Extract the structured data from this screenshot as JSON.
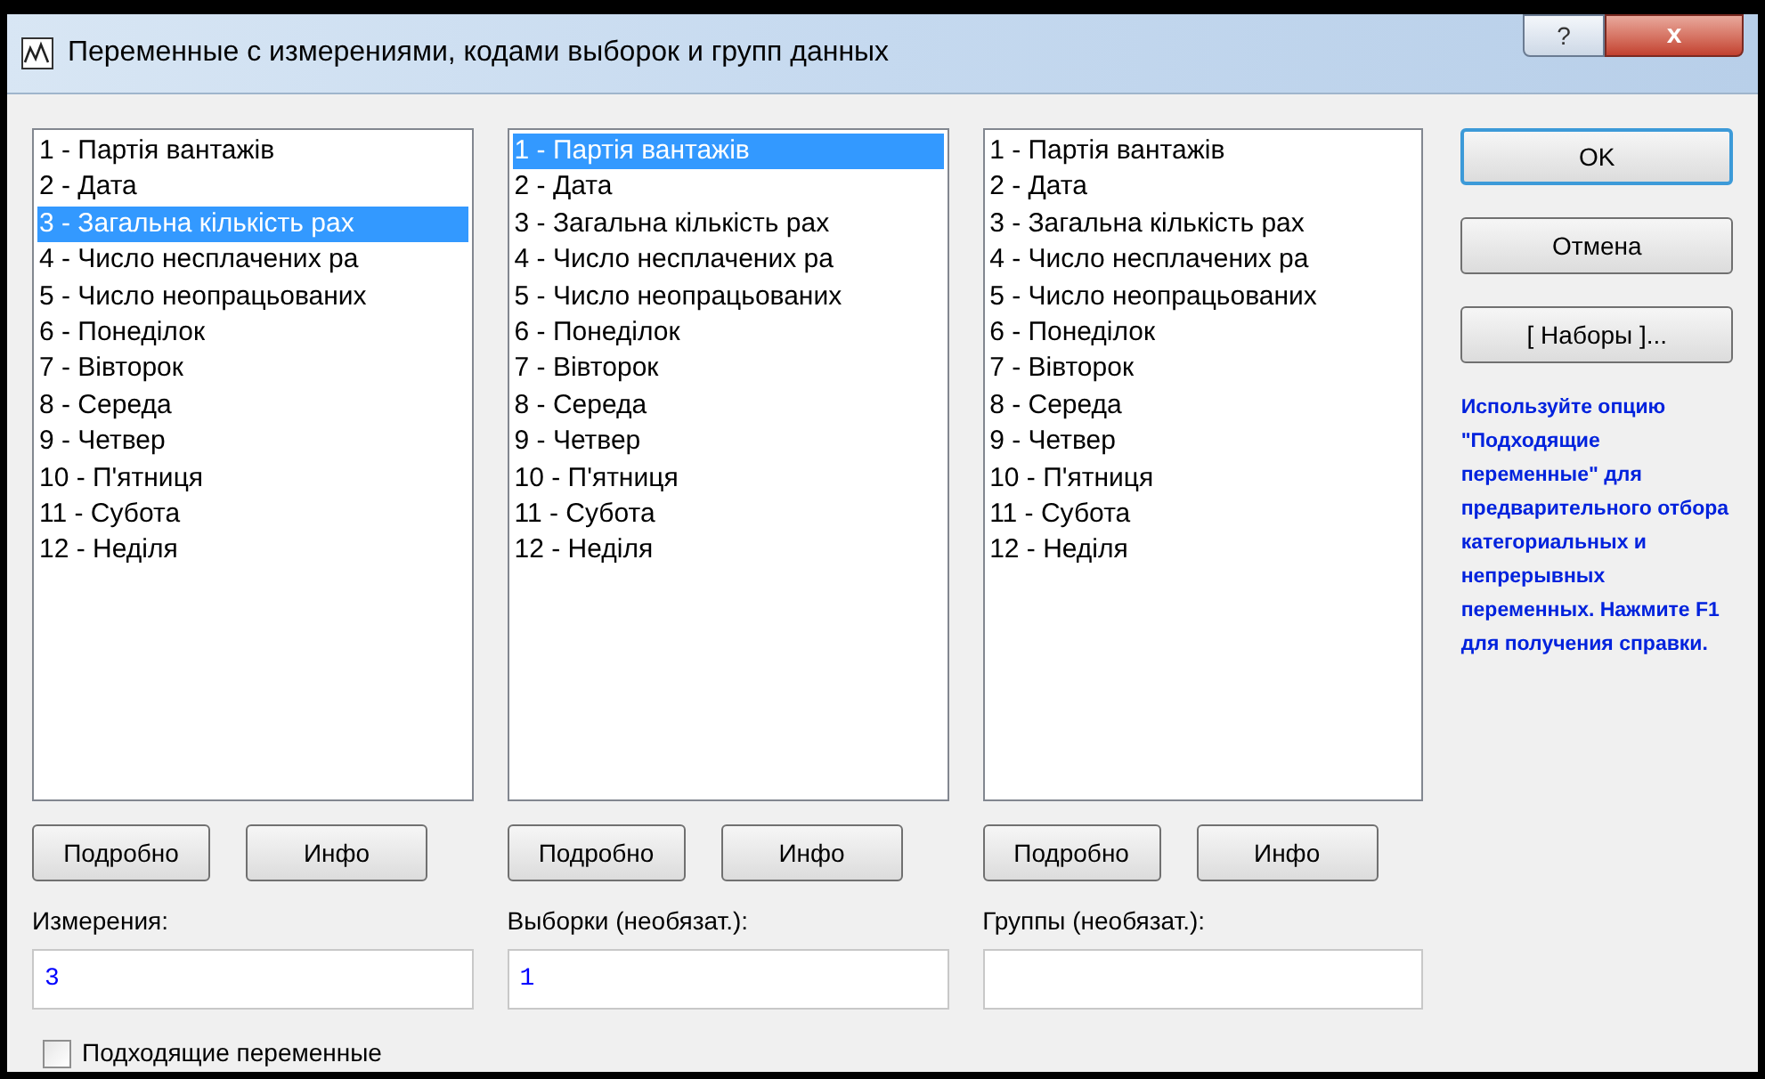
{
  "window": {
    "title": "Переменные с измерениями, кодами выборок и групп данных",
    "help_button": "?",
    "close_button": "x"
  },
  "columns": [
    {
      "items": [
        {
          "label": "1 - Партія вантажів",
          "selected": false
        },
        {
          "label": "2 - Дата",
          "selected": false
        },
        {
          "label": "3 - Загальна кількість рах",
          "selected": true
        },
        {
          "label": "4 - Число несплачених ра",
          "selected": false
        },
        {
          "label": "5 - Число неопрацьованих",
          "selected": false
        },
        {
          "label": "6 - Понеділок",
          "selected": false
        },
        {
          "label": "7 - Вівторок",
          "selected": false
        },
        {
          "label": "8 - Середа",
          "selected": false
        },
        {
          "label": "9 - Четвер",
          "selected": false
        },
        {
          "label": "10 - П'ятниця",
          "selected": false
        },
        {
          "label": "11 - Субота",
          "selected": false
        },
        {
          "label": "12 - Неділя",
          "selected": false
        }
      ],
      "buttons": [
        "Подробно",
        "Инфо"
      ],
      "field_label": "Измерения:",
      "value": "3"
    },
    {
      "items": [
        {
          "label": "1 - Партія вантажів",
          "selected": true
        },
        {
          "label": "2 - Дата",
          "selected": false
        },
        {
          "label": "3 - Загальна кількість рах",
          "selected": false
        },
        {
          "label": "4 - Число несплачених ра",
          "selected": false
        },
        {
          "label": "5 - Число неопрацьованих",
          "selected": false
        },
        {
          "label": "6 - Понеділок",
          "selected": false
        },
        {
          "label": "7 - Вівторок",
          "selected": false
        },
        {
          "label": "8 - Середа",
          "selected": false
        },
        {
          "label": "9 - Четвер",
          "selected": false
        },
        {
          "label": "10 - П'ятниця",
          "selected": false
        },
        {
          "label": "11 - Субота",
          "selected": false
        },
        {
          "label": "12 - Неділя",
          "selected": false
        }
      ],
      "buttons": [
        "Подробно",
        "Инфо"
      ],
      "field_label": "Выборки (необязат.):",
      "value": "1"
    },
    {
      "items": [
        {
          "label": "1 - Партія вантажів",
          "selected": false
        },
        {
          "label": "2 - Дата",
          "selected": false
        },
        {
          "label": "3 - Загальна кількість рах",
          "selected": false
        },
        {
          "label": "4 - Число несплачених ра",
          "selected": false
        },
        {
          "label": "5 - Число неопрацьованих",
          "selected": false
        },
        {
          "label": "6 - Понеділок",
          "selected": false
        },
        {
          "label": "7 - Вівторок",
          "selected": false
        },
        {
          "label": "8 - Середа",
          "selected": false
        },
        {
          "label": "9 - Четвер",
          "selected": false
        },
        {
          "label": "10 - П'ятниця",
          "selected": false
        },
        {
          "label": "11 - Субота",
          "selected": false
        },
        {
          "label": "12 - Неділя",
          "selected": false
        }
      ],
      "buttons": [
        "Подробно",
        "Инфо"
      ],
      "field_label": "Группы (необязат.):"
    }
  ],
  "side_buttons": [
    "OK",
    "Отмена",
    "[ Наборы ]..."
  ],
  "help_text": "Используйте опцию \"Подходящие переменные\" для предварительного отбора категориальных и непрерывных переменных. Нажмите F1 для получения справки.",
  "checkbox": {
    "label": "Подходящие переменные",
    "checked": false
  }
}
